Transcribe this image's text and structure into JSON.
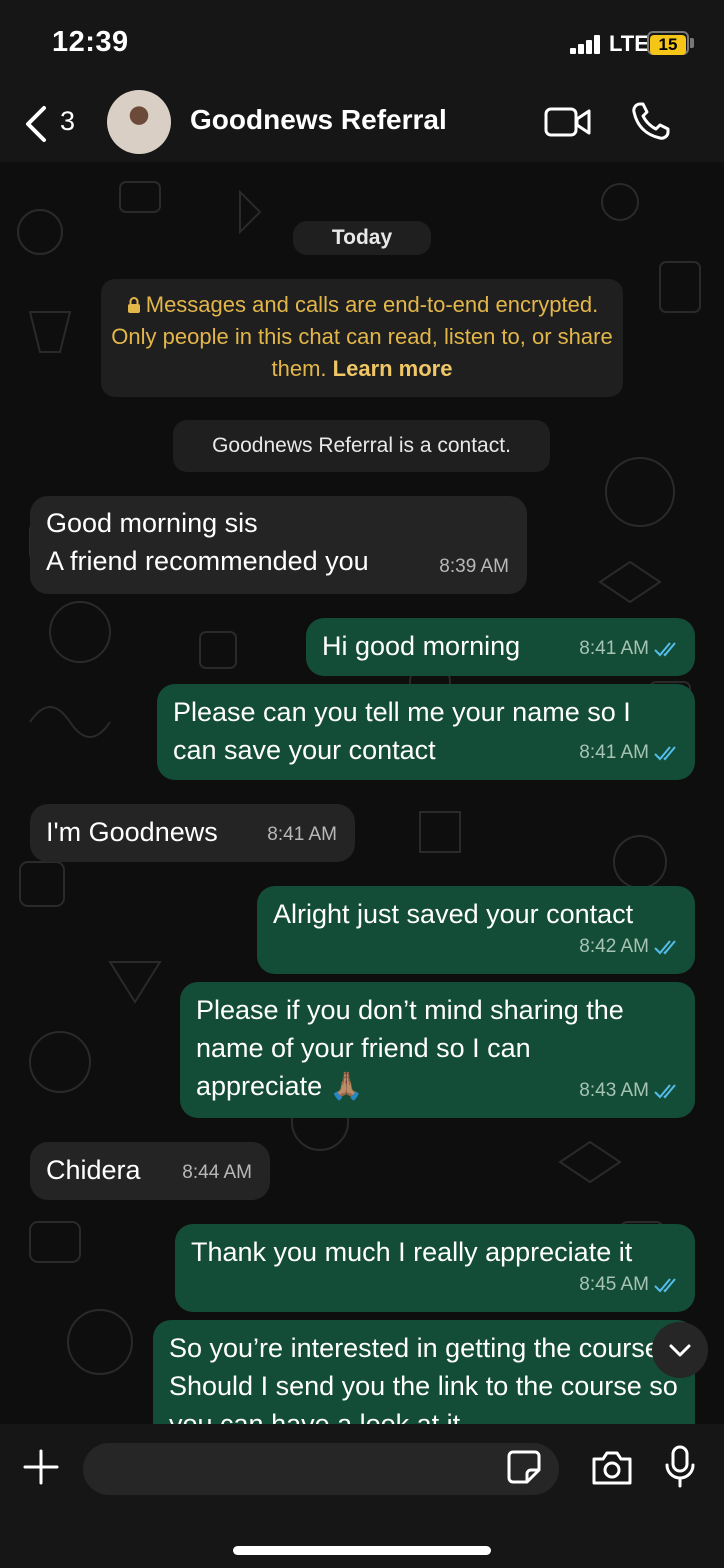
{
  "status_bar": {
    "time": "12:39",
    "network": "LTE",
    "battery": "15"
  },
  "header": {
    "back_count": "3",
    "contact_name": "Goodnews Referral"
  },
  "chat": {
    "date_label": "Today",
    "encryption_notice": "Messages and calls are end-to-end encrypted. Only people in this chat can read, listen to, or share them.",
    "learn_more": "Learn more",
    "contact_notice": "Goodnews Referral is a contact.",
    "messages": [
      {
        "direction": "in",
        "text": "Good morning sis\nA friend recommended you",
        "time": "8:39 AM"
      },
      {
        "direction": "out",
        "text": "Hi good morning",
        "time": "8:41 AM",
        "status": "read"
      },
      {
        "direction": "out",
        "text": "Please can you tell me your name so I can save your contact",
        "time": "8:41 AM",
        "status": "read"
      },
      {
        "direction": "in",
        "text": "I'm Goodnews",
        "time": "8:41 AM"
      },
      {
        "direction": "out",
        "text": "Alright just saved your contact",
        "time": "8:42 AM",
        "status": "read"
      },
      {
        "direction": "out",
        "text": "Please if you don’t mind sharing the name of your friend so I can appreciate 🙏🏽",
        "time": "8:43 AM",
        "status": "read"
      },
      {
        "direction": "in",
        "text": "Chidera",
        "time": "8:44 AM"
      },
      {
        "direction": "out",
        "text": "Thank you much I really appreciate it",
        "time": "8:45 AM",
        "status": "read"
      },
      {
        "direction": "out",
        "text": "So you’re interested in getting the course? Should I send you the link to the course so you can have a look at it",
        "time": "",
        "status": ""
      }
    ]
  },
  "icons": {
    "back": "chevron-left-icon",
    "video": "video-camera-icon",
    "call": "phone-icon",
    "plus": "plus-icon",
    "sticker": "sticker-icon",
    "camera": "camera-icon",
    "mic": "microphone-icon",
    "scroll": "chevron-down-icon",
    "lock": "lock-icon"
  },
  "colors": {
    "incoming_bubble": "#242424",
    "outgoing_bubble": "#144d37",
    "read_ticks": "#53bdeb",
    "encryption_text": "#e3b64a"
  }
}
